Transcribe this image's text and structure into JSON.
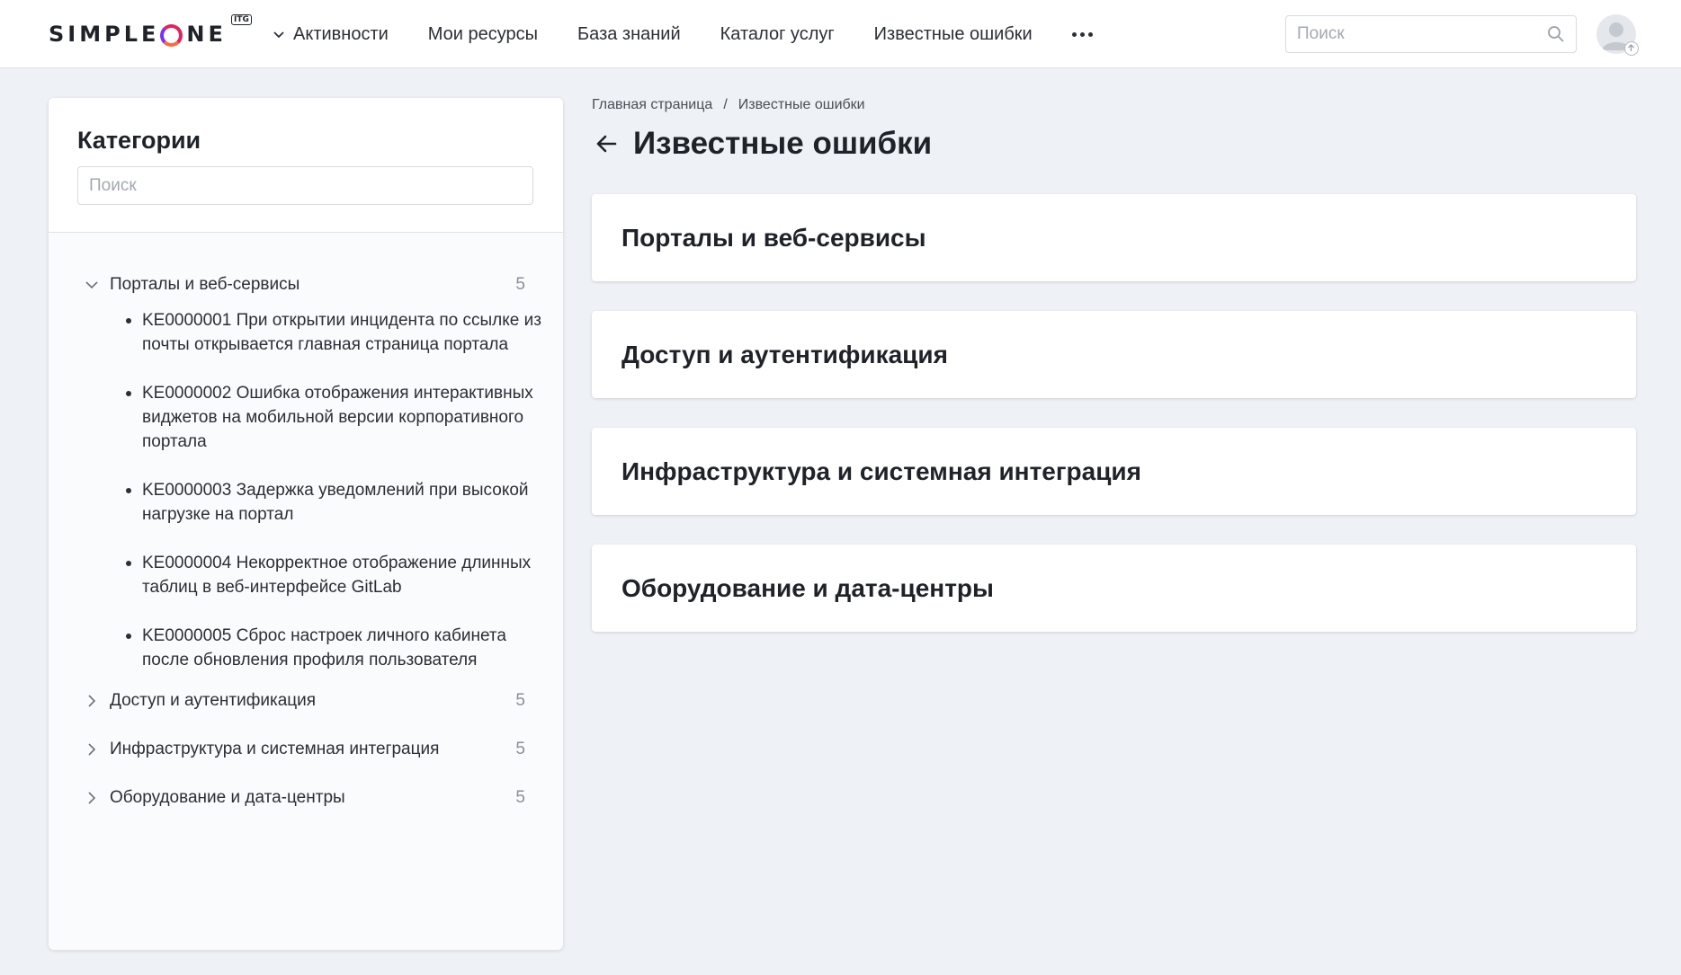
{
  "header": {
    "logo_text": "SIMPLEONE",
    "logo_badge": "ITG",
    "nav": [
      {
        "label": "Активности"
      },
      {
        "label": "Мои ресурсы"
      },
      {
        "label": "База знаний"
      },
      {
        "label": "Каталог услуг"
      },
      {
        "label": "Известные ошибки"
      }
    ],
    "more_icon": "ellipsis-icon",
    "search_placeholder": "Поиск"
  },
  "sidebar": {
    "title": "Категории",
    "search_placeholder": "Поиск",
    "categories": [
      {
        "label": "Порталы и веб-сервисы",
        "count": "5",
        "expanded": true,
        "items": [
          "KE0000001 При открытии инцидента по ссылке из почты открывается главная страница портала",
          "KE0000002 Ошибка отображения интерактивных виджетов на мобильной версии корпоративного портала",
          "KE0000003 Задержка уведомлений при высокой нагрузке на портал",
          "KE0000004 Некорректное отображение длинных таблиц в веб-интерфейсе GitLab",
          "KE0000005 Сброс настроек личного кабинета после обновления профиля пользователя"
        ]
      },
      {
        "label": "Доступ и аутентификация",
        "count": "5",
        "expanded": false
      },
      {
        "label": "Инфраструктура и системная интеграция",
        "count": "5",
        "expanded": false
      },
      {
        "label": "Оборудование и дата-центры",
        "count": "5",
        "expanded": false
      }
    ]
  },
  "main": {
    "breadcrumb": {
      "home": "Главная страница",
      "separator": "/",
      "current": "Известные ошибки"
    },
    "title": "Известные ошибки",
    "cards": [
      {
        "label": "Порталы и веб-сервисы"
      },
      {
        "label": "Доступ и аутентификация"
      },
      {
        "label": "Инфраструктура и системная интеграция"
      },
      {
        "label": "Оборудование и дата-центры"
      }
    ]
  }
}
